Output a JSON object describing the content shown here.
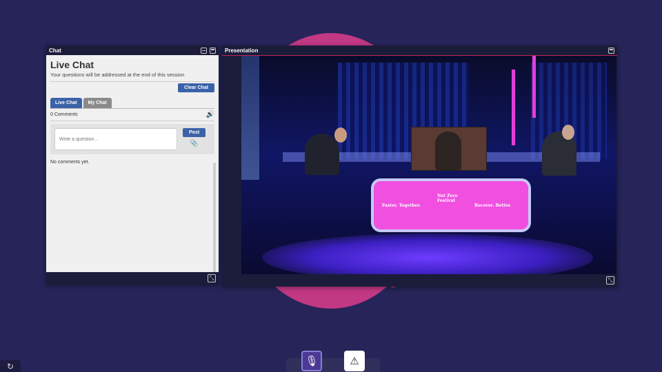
{
  "chat_panel": {
    "header_title": "Chat",
    "title": "Live Chat",
    "subtitle": "Your questions will be addressed at the end of this session",
    "clear_button": "Clear Chat",
    "tabs": [
      {
        "label": "Live Chat",
        "active": true
      },
      {
        "label": "My Chat",
        "active": false
      }
    ],
    "comment_count": "0 Comments",
    "input_placeholder": "Write a question...",
    "post_button": "Post",
    "empty_state": "No comments yet."
  },
  "presentation_panel": {
    "header_title": "Presentation",
    "desk_texts": [
      "Faster. Together.",
      "Net Zero Festival",
      "Recover. Better."
    ]
  },
  "bottom_controls": {
    "mic_icon": "microphone-icon",
    "warning_icon": "warning-icon",
    "refresh_icon": "refresh-icon"
  },
  "colors": {
    "background": "#262458",
    "accent_pink": "#c93a86",
    "button_blue": "#3a62a8"
  }
}
